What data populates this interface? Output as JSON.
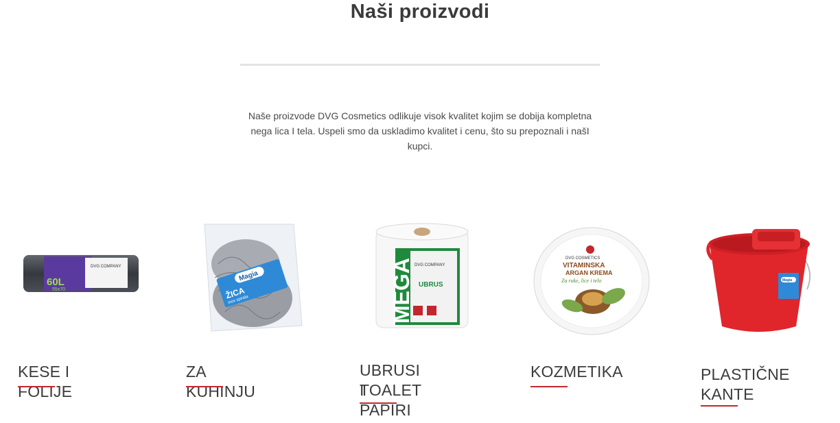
{
  "section": {
    "title": "Naši proizvodi",
    "description": "Naše proizvode DVG Cosmetics odlikuje visok kvalitet kojim se dobija kompletna nega lica I tela. Uspeli smo da uskladimo kvalitet i cenu, što su prepoznali i našI kupci."
  },
  "products": [
    {
      "name": "KESE I FOLIJE",
      "image_label": "60L",
      "image_sub": "55x70",
      "image_brand": "DVG COMPANY"
    },
    {
      "name": "ZA KUHINJU",
      "image_label": "ŽICA",
      "image_sub": "inox spirala",
      "image_brand": "Magia"
    },
    {
      "name_line1": "UBRUSI I",
      "name_line2": "TOALET PAPIRI",
      "image_label": "MEGA",
      "image_sub": "UBRUS",
      "image_brand": "DVG COMPANY"
    },
    {
      "name": "KOZMETIKA",
      "image_label": "VITAMINSKA",
      "image_sub": "ARGAN KREMA",
      "image_brand": "DVG COSMETICS",
      "image_note": "Za ruke, lice i telo"
    },
    {
      "name_line1": "PLASTIČNE",
      "name_line2": "KANTE",
      "image_brand": "Magia"
    }
  ],
  "colors": {
    "accent": "#c1272d",
    "title": "#3a3a3a",
    "divider": "#e3e3e3"
  }
}
